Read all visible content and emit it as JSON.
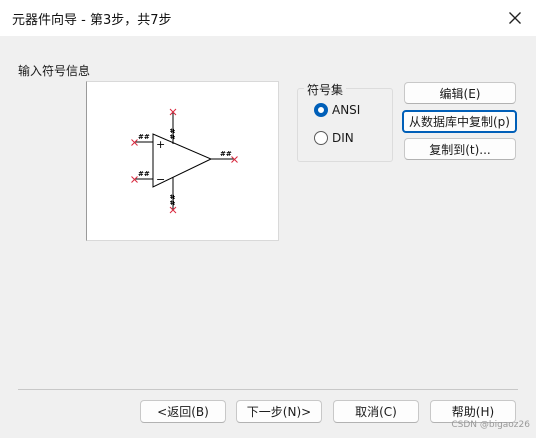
{
  "window": {
    "title": "元器件向导 - 第3步，共7步",
    "close_icon": "close-icon"
  },
  "symbol_info": {
    "label": "输入符号信息",
    "preview_icon": "opamp-symbol-icon",
    "pin_marks": {
      "input_plus": "##",
      "input_minus": "##",
      "output": "##",
      "power_top": "##",
      "power_bottom": "##"
    },
    "plus_sign": "+",
    "minus_sign": "−"
  },
  "symbol_set": {
    "title": "符号集",
    "options": [
      {
        "label": "ANSI",
        "checked": true
      },
      {
        "label": "DIN",
        "checked": false
      }
    ]
  },
  "actions": {
    "edit": "编辑(E)",
    "copy_from_db": "从数据库中复制(p)",
    "copy_to": "复制到(t)..."
  },
  "footer": {
    "back": "<返回(B)",
    "next": "下一步(N)>",
    "cancel": "取消(C)",
    "help": "帮助(H)"
  },
  "watermark": "CSDN @bigaoz26",
  "colors": {
    "accent": "#005fb8",
    "pin_marker": "#d9283e"
  }
}
